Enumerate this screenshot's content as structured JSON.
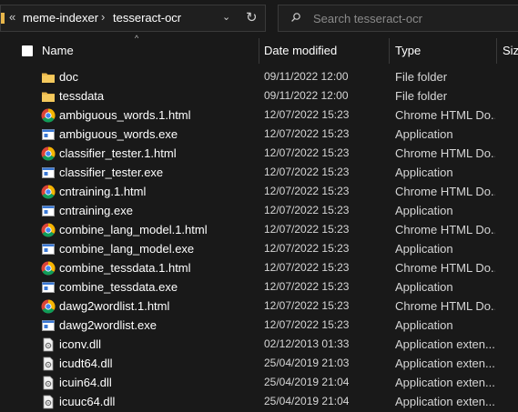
{
  "address": {
    "prefix": "«",
    "crumbs": [
      "meme-indexer",
      "tesseract-ocr"
    ],
    "separator": "›",
    "dropdown_glyph": "⌄",
    "refresh_glyph": "↻"
  },
  "search": {
    "placeholder": "Search tesseract-ocr"
  },
  "columns": {
    "name": "Name",
    "date": "Date modified",
    "type": "Type",
    "size": "Siz"
  },
  "sort_indicator": "^",
  "files": [
    {
      "name": "doc",
      "date": "09/11/2022 12:00",
      "type": "File folder",
      "icon": "folder-icon"
    },
    {
      "name": "tessdata",
      "date": "09/11/2022 12:00",
      "type": "File folder",
      "icon": "folder-icon"
    },
    {
      "name": "ambiguous_words.1.html",
      "date": "12/07/2022 15:23",
      "type": "Chrome HTML Do...",
      "icon": "chrome-icon"
    },
    {
      "name": "ambiguous_words.exe",
      "date": "12/07/2022 15:23",
      "type": "Application",
      "icon": "application-icon"
    },
    {
      "name": "classifier_tester.1.html",
      "date": "12/07/2022 15:23",
      "type": "Chrome HTML Do...",
      "icon": "chrome-icon"
    },
    {
      "name": "classifier_tester.exe",
      "date": "12/07/2022 15:23",
      "type": "Application",
      "icon": "application-icon"
    },
    {
      "name": "cntraining.1.html",
      "date": "12/07/2022 15:23",
      "type": "Chrome HTML Do...",
      "icon": "chrome-icon"
    },
    {
      "name": "cntraining.exe",
      "date": "12/07/2022 15:23",
      "type": "Application",
      "icon": "application-icon"
    },
    {
      "name": "combine_lang_model.1.html",
      "date": "12/07/2022 15:23",
      "type": "Chrome HTML Do...",
      "icon": "chrome-icon"
    },
    {
      "name": "combine_lang_model.exe",
      "date": "12/07/2022 15:23",
      "type": "Application",
      "icon": "application-icon"
    },
    {
      "name": "combine_tessdata.1.html",
      "date": "12/07/2022 15:23",
      "type": "Chrome HTML Do...",
      "icon": "chrome-icon"
    },
    {
      "name": "combine_tessdata.exe",
      "date": "12/07/2022 15:23",
      "type": "Application",
      "icon": "application-icon"
    },
    {
      "name": "dawg2wordlist.1.html",
      "date": "12/07/2022 15:23",
      "type": "Chrome HTML Do...",
      "icon": "chrome-icon"
    },
    {
      "name": "dawg2wordlist.exe",
      "date": "12/07/2022 15:23",
      "type": "Application",
      "icon": "application-icon"
    },
    {
      "name": "iconv.dll",
      "date": "02/12/2013 01:33",
      "type": "Application exten...",
      "icon": "dll-icon"
    },
    {
      "name": "icudt64.dll",
      "date": "25/04/2019 21:03",
      "type": "Application exten...",
      "icon": "dll-icon"
    },
    {
      "name": "icuin64.dll",
      "date": "25/04/2019 21:04",
      "type": "Application exten...",
      "icon": "dll-icon"
    },
    {
      "name": "icuuc64.dll",
      "date": "25/04/2019 21:04",
      "type": "Application exten...",
      "icon": "dll-icon"
    }
  ],
  "colors": {
    "background": "#191919",
    "folder": "#e8b64a",
    "app_blue": "#3a78d4"
  }
}
